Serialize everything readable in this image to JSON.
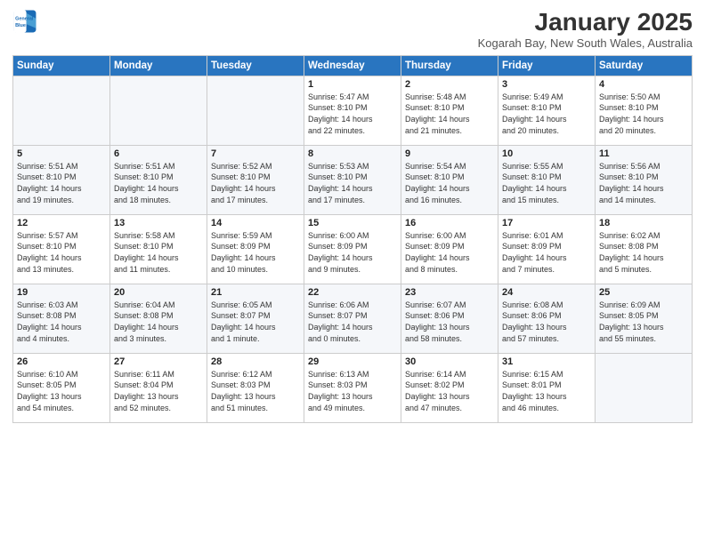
{
  "logo": {
    "line1": "General",
    "line2": "Blue"
  },
  "title": "January 2025",
  "location": "Kogarah Bay, New South Wales, Australia",
  "days_header": [
    "Sunday",
    "Monday",
    "Tuesday",
    "Wednesday",
    "Thursday",
    "Friday",
    "Saturday"
  ],
  "weeks": [
    [
      {
        "num": "",
        "info": ""
      },
      {
        "num": "",
        "info": ""
      },
      {
        "num": "",
        "info": ""
      },
      {
        "num": "1",
        "info": "Sunrise: 5:47 AM\nSunset: 8:10 PM\nDaylight: 14 hours\nand 22 minutes."
      },
      {
        "num": "2",
        "info": "Sunrise: 5:48 AM\nSunset: 8:10 PM\nDaylight: 14 hours\nand 21 minutes."
      },
      {
        "num": "3",
        "info": "Sunrise: 5:49 AM\nSunset: 8:10 PM\nDaylight: 14 hours\nand 20 minutes."
      },
      {
        "num": "4",
        "info": "Sunrise: 5:50 AM\nSunset: 8:10 PM\nDaylight: 14 hours\nand 20 minutes."
      }
    ],
    [
      {
        "num": "5",
        "info": "Sunrise: 5:51 AM\nSunset: 8:10 PM\nDaylight: 14 hours\nand 19 minutes."
      },
      {
        "num": "6",
        "info": "Sunrise: 5:51 AM\nSunset: 8:10 PM\nDaylight: 14 hours\nand 18 minutes."
      },
      {
        "num": "7",
        "info": "Sunrise: 5:52 AM\nSunset: 8:10 PM\nDaylight: 14 hours\nand 17 minutes."
      },
      {
        "num": "8",
        "info": "Sunrise: 5:53 AM\nSunset: 8:10 PM\nDaylight: 14 hours\nand 17 minutes."
      },
      {
        "num": "9",
        "info": "Sunrise: 5:54 AM\nSunset: 8:10 PM\nDaylight: 14 hours\nand 16 minutes."
      },
      {
        "num": "10",
        "info": "Sunrise: 5:55 AM\nSunset: 8:10 PM\nDaylight: 14 hours\nand 15 minutes."
      },
      {
        "num": "11",
        "info": "Sunrise: 5:56 AM\nSunset: 8:10 PM\nDaylight: 14 hours\nand 14 minutes."
      }
    ],
    [
      {
        "num": "12",
        "info": "Sunrise: 5:57 AM\nSunset: 8:10 PM\nDaylight: 14 hours\nand 13 minutes."
      },
      {
        "num": "13",
        "info": "Sunrise: 5:58 AM\nSunset: 8:10 PM\nDaylight: 14 hours\nand 11 minutes."
      },
      {
        "num": "14",
        "info": "Sunrise: 5:59 AM\nSunset: 8:09 PM\nDaylight: 14 hours\nand 10 minutes."
      },
      {
        "num": "15",
        "info": "Sunrise: 6:00 AM\nSunset: 8:09 PM\nDaylight: 14 hours\nand 9 minutes."
      },
      {
        "num": "16",
        "info": "Sunrise: 6:00 AM\nSunset: 8:09 PM\nDaylight: 14 hours\nand 8 minutes."
      },
      {
        "num": "17",
        "info": "Sunrise: 6:01 AM\nSunset: 8:09 PM\nDaylight: 14 hours\nand 7 minutes."
      },
      {
        "num": "18",
        "info": "Sunrise: 6:02 AM\nSunset: 8:08 PM\nDaylight: 14 hours\nand 5 minutes."
      }
    ],
    [
      {
        "num": "19",
        "info": "Sunrise: 6:03 AM\nSunset: 8:08 PM\nDaylight: 14 hours\nand 4 minutes."
      },
      {
        "num": "20",
        "info": "Sunrise: 6:04 AM\nSunset: 8:08 PM\nDaylight: 14 hours\nand 3 minutes."
      },
      {
        "num": "21",
        "info": "Sunrise: 6:05 AM\nSunset: 8:07 PM\nDaylight: 14 hours\nand 1 minute."
      },
      {
        "num": "22",
        "info": "Sunrise: 6:06 AM\nSunset: 8:07 PM\nDaylight: 14 hours\nand 0 minutes."
      },
      {
        "num": "23",
        "info": "Sunrise: 6:07 AM\nSunset: 8:06 PM\nDaylight: 13 hours\nand 58 minutes."
      },
      {
        "num": "24",
        "info": "Sunrise: 6:08 AM\nSunset: 8:06 PM\nDaylight: 13 hours\nand 57 minutes."
      },
      {
        "num": "25",
        "info": "Sunrise: 6:09 AM\nSunset: 8:05 PM\nDaylight: 13 hours\nand 55 minutes."
      }
    ],
    [
      {
        "num": "26",
        "info": "Sunrise: 6:10 AM\nSunset: 8:05 PM\nDaylight: 13 hours\nand 54 minutes."
      },
      {
        "num": "27",
        "info": "Sunrise: 6:11 AM\nSunset: 8:04 PM\nDaylight: 13 hours\nand 52 minutes."
      },
      {
        "num": "28",
        "info": "Sunrise: 6:12 AM\nSunset: 8:03 PM\nDaylight: 13 hours\nand 51 minutes."
      },
      {
        "num": "29",
        "info": "Sunrise: 6:13 AM\nSunset: 8:03 PM\nDaylight: 13 hours\nand 49 minutes."
      },
      {
        "num": "30",
        "info": "Sunrise: 6:14 AM\nSunset: 8:02 PM\nDaylight: 13 hours\nand 47 minutes."
      },
      {
        "num": "31",
        "info": "Sunrise: 6:15 AM\nSunset: 8:01 PM\nDaylight: 13 hours\nand 46 minutes."
      },
      {
        "num": "",
        "info": ""
      }
    ]
  ]
}
